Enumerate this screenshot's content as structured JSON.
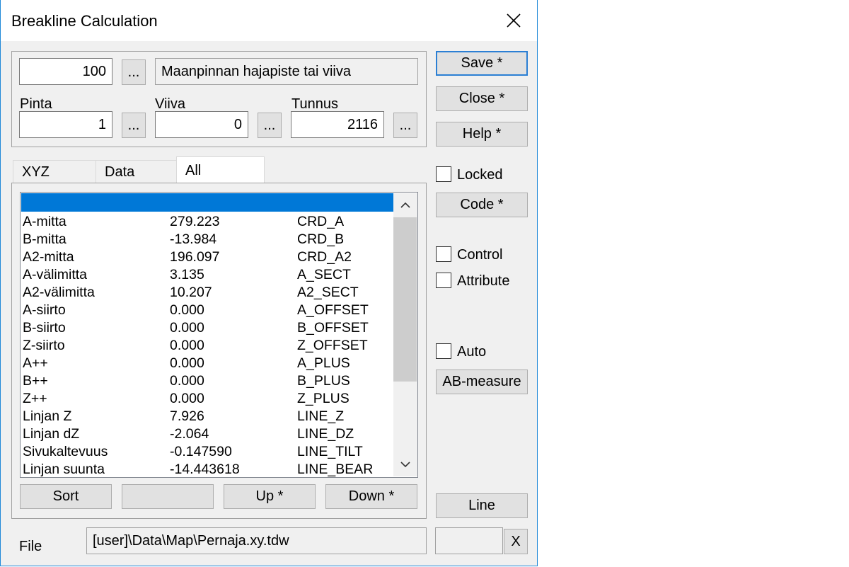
{
  "window": {
    "title": "Breakline Calculation"
  },
  "code_row": {
    "code_value": "100",
    "browse_label": "...",
    "description": "Maanpinnan hajapiste tai viiva"
  },
  "fields": {
    "pinta": {
      "label": "Pinta",
      "value": "1",
      "browse_label": "..."
    },
    "viiva": {
      "label": "Viiva",
      "value": "0",
      "browse_label": "..."
    },
    "tunnus": {
      "label": "Tunnus",
      "value": "2116",
      "browse_label": "..."
    }
  },
  "tabs": [
    {
      "label": "XYZ",
      "active": false
    },
    {
      "label": "Data",
      "active": false
    },
    {
      "label": "All",
      "active": true
    }
  ],
  "list": {
    "rows": [
      {
        "name": "A-mitta",
        "value": "279.223",
        "code": "CRD_A"
      },
      {
        "name": "B-mitta",
        "value": "-13.984",
        "code": "CRD_B"
      },
      {
        "name": "A2-mitta",
        "value": "196.097",
        "code": "CRD_A2"
      },
      {
        "name": "A-välimitta",
        "value": "3.135",
        "code": "A_SECT"
      },
      {
        "name": "A2-välimitta",
        "value": "10.207",
        "code": "A2_SECT"
      },
      {
        "name": "A-siirto",
        "value": "0.000",
        "code": "A_OFFSET"
      },
      {
        "name": "B-siirto",
        "value": "0.000",
        "code": "B_OFFSET"
      },
      {
        "name": "Z-siirto",
        "value": "0.000",
        "code": "Z_OFFSET"
      },
      {
        "name": "A++",
        "value": "0.000",
        "code": "A_PLUS"
      },
      {
        "name": "B++",
        "value": "0.000",
        "code": "B_PLUS"
      },
      {
        "name": "Z++",
        "value": "0.000",
        "code": "Z_PLUS"
      },
      {
        "name": "Linjan Z",
        "value": "7.926",
        "code": "LINE_Z"
      },
      {
        "name": "Linjan dZ",
        "value": "-2.064",
        "code": "LINE_DZ"
      },
      {
        "name": "Sivukaltevuus",
        "value": "-0.147590",
        "code": "LINE_TILT"
      },
      {
        "name": "Linjan suunta",
        "value": "-14.443618",
        "code": "LINE_BEAR"
      }
    ]
  },
  "list_buttons": {
    "sort": "Sort",
    "blank": "",
    "up": "Up *",
    "down": "Down *"
  },
  "right_panel": {
    "save": "Save *",
    "close": "Close *",
    "help": "Help *",
    "locked": "Locked",
    "code": "Code *",
    "control": "Control",
    "attribute": "Attribute",
    "auto": "Auto",
    "ab_measure": "AB-measure",
    "line": "Line"
  },
  "file": {
    "label": "File",
    "path": "[user]\\Data\\Map\\Pernaja.xy.tdw",
    "clear_label": "X",
    "extra_value": ""
  },
  "icons": {
    "close": "close-icon",
    "scroll_up": "chevron-up-icon",
    "scroll_down": "chevron-down-icon"
  },
  "colors": {
    "accent": "#0078d7",
    "window_border": "#1e88d8"
  }
}
